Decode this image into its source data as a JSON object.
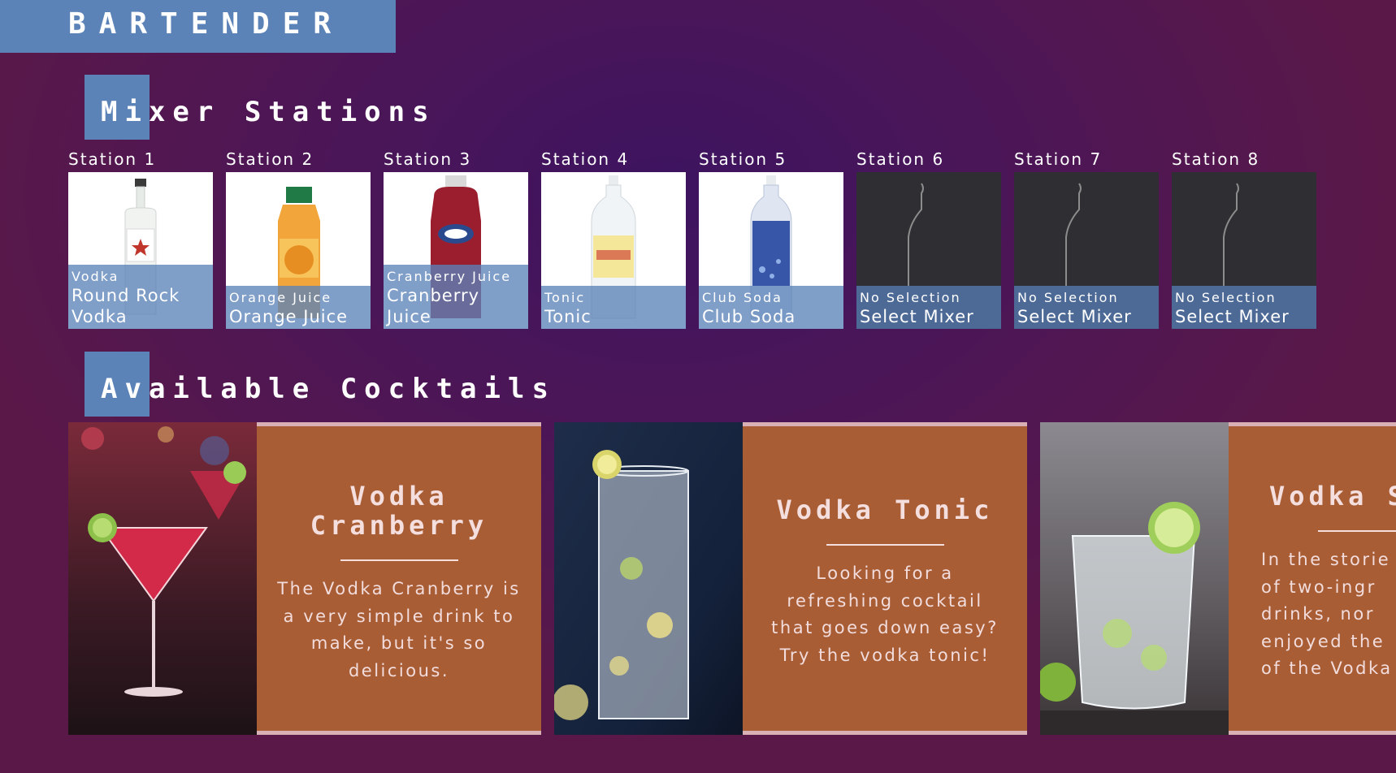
{
  "app": {
    "title": "BARTENDER"
  },
  "sections": {
    "mixer_title": "Mixer Stations",
    "cocktails_title": "Available Cocktails"
  },
  "stations": [
    {
      "label": "Station 1",
      "type": "Vodka",
      "name": "Round Rock Vodka",
      "filled": true,
      "bottle": "vodka-bottle-icon",
      "color": "#eef0ee"
    },
    {
      "label": "Station 2",
      "type": "Orange Juice",
      "name": "Orange Juice",
      "filled": true,
      "bottle": "orange-juice-bottle-icon",
      "color": "#f2a53a"
    },
    {
      "label": "Station 3",
      "type": "Cranberry Juice",
      "name": "Cranberry Juice",
      "filled": true,
      "bottle": "cranberry-juice-bottle-icon",
      "color": "#9b1e2e"
    },
    {
      "label": "Station 4",
      "type": "Tonic",
      "name": "Tonic",
      "filled": true,
      "bottle": "tonic-bottle-icon",
      "color": "#f5e79a"
    },
    {
      "label": "Station 5",
      "type": "Club Soda",
      "name": "Club Soda",
      "filled": true,
      "bottle": "club-soda-bottle-icon",
      "color": "#3856a8"
    },
    {
      "label": "Station 6",
      "type": "No Selection",
      "name": "Select Mixer",
      "filled": false,
      "bottle": "empty-bottle-icon",
      "color": "#2f2f33"
    },
    {
      "label": "Station 7",
      "type": "No Selection",
      "name": "Select Mixer",
      "filled": false,
      "bottle": "empty-bottle-icon",
      "color": "#2f2f33"
    },
    {
      "label": "Station 8",
      "type": "No Selection",
      "name": "Select Mixer",
      "filled": false,
      "bottle": "empty-bottle-icon",
      "color": "#2f2f33"
    }
  ],
  "cocktails": [
    {
      "name": "Vodka Cranberry",
      "description": "The Vodka Cranberry is a very simple drink to make, but it's so delicious.",
      "photo": "vodka-cranberry-photo"
    },
    {
      "name": "Vodka Tonic",
      "description": "Looking for a refreshing cocktail that goes down easy? Try the vodka tonic!",
      "photo": "vodka-tonic-photo"
    },
    {
      "name": "Vodka S",
      "description": "In the storie of two-ingr drinks, nor enjoyed the of the Vodka",
      "photo": "vodka-soda-photo"
    }
  ],
  "colors": {
    "accent_blue": "#5b83b8",
    "card_panel": "#a85d35",
    "panel_border": "#d8b0b6",
    "background": "#4a1658"
  }
}
